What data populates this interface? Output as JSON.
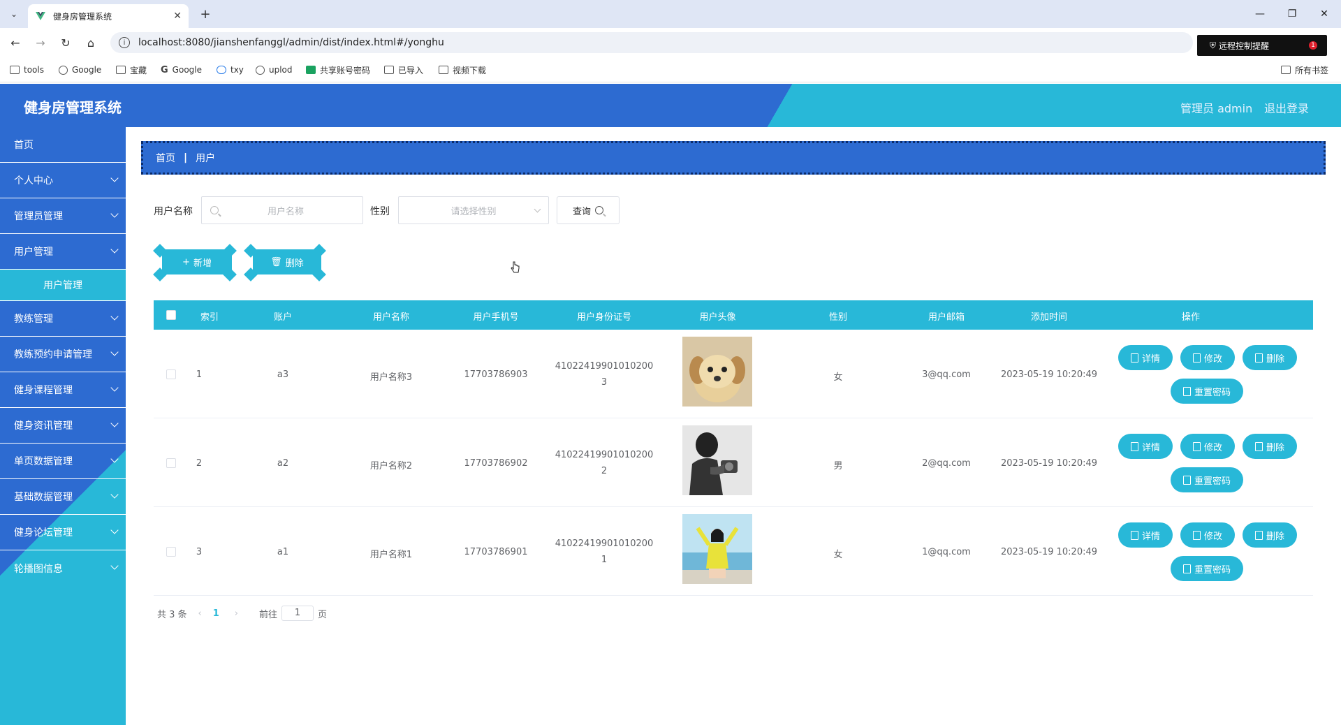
{
  "browser": {
    "tab_title": "健身房管理系统",
    "url": "localhost:8080/jianshenfanggl/admin/dist/index.html#/yonghu",
    "remote_badge": "远程控制提醒",
    "remote_count": "1",
    "bookmarks": [
      "tools",
      "Google",
      "宝藏",
      "Google",
      "txy",
      "uplod",
      "共享账号密码",
      "已导入",
      "视频下载"
    ],
    "all_bookmarks": "所有书签"
  },
  "header": {
    "title": "健身房管理系统",
    "user": "管理员 admin",
    "logout": "退出登录"
  },
  "sidebar": {
    "items": [
      {
        "label": "首页"
      },
      {
        "label": "个人中心"
      },
      {
        "label": "管理员管理"
      },
      {
        "label": "用户管理"
      },
      {
        "label": "教练管理"
      },
      {
        "label": "教练预约申请管理"
      },
      {
        "label": "健身课程管理"
      },
      {
        "label": "健身资讯管理"
      },
      {
        "label": "单页数据管理"
      },
      {
        "label": "基础数据管理"
      },
      {
        "label": "健身论坛管理"
      },
      {
        "label": "轮播图信息"
      }
    ],
    "sub_active": "用户管理"
  },
  "breadcrumb": {
    "home": "首页",
    "current": "用户"
  },
  "search": {
    "name_label": "用户名称",
    "name_placeholder": "用户名称",
    "gender_label": "性别",
    "gender_placeholder": "请选择性别",
    "query_btn": "查询"
  },
  "actions": {
    "add": "新增",
    "delete": "删除"
  },
  "table": {
    "headers": [
      "索引",
      "账户",
      "用户名称",
      "用户手机号",
      "用户身份证号",
      "用户头像",
      "性别",
      "用户邮箱",
      "添加时间",
      "操作"
    ],
    "rows": [
      {
        "index": "1",
        "account": "a3",
        "name": "用户名称3",
        "phone": "17703786903",
        "id_line1": "41022419901010200",
        "id_line2": "3",
        "gender": "女",
        "email": "3@qq.com",
        "time": "2023-05-19 10:20:49"
      },
      {
        "index": "2",
        "account": "a2",
        "name": "用户名称2",
        "phone": "17703786902",
        "id_line1": "41022419901010200",
        "id_line2": "2",
        "gender": "男",
        "email": "2@qq.com",
        "time": "2023-05-19 10:20:49"
      },
      {
        "index": "3",
        "account": "a1",
        "name": "用户名称1",
        "phone": "17703786901",
        "id_line1": "41022419901010200",
        "id_line2": "1",
        "gender": "女",
        "email": "1@qq.com",
        "time": "2023-05-19 10:20:49"
      }
    ],
    "ops": {
      "detail": "详情",
      "edit": "修改",
      "delete": "删除",
      "reset": "重置密码"
    }
  },
  "pager": {
    "total": "共 3 条",
    "page": "1",
    "goto": "前往",
    "goto_value": "1",
    "unit": "页"
  }
}
